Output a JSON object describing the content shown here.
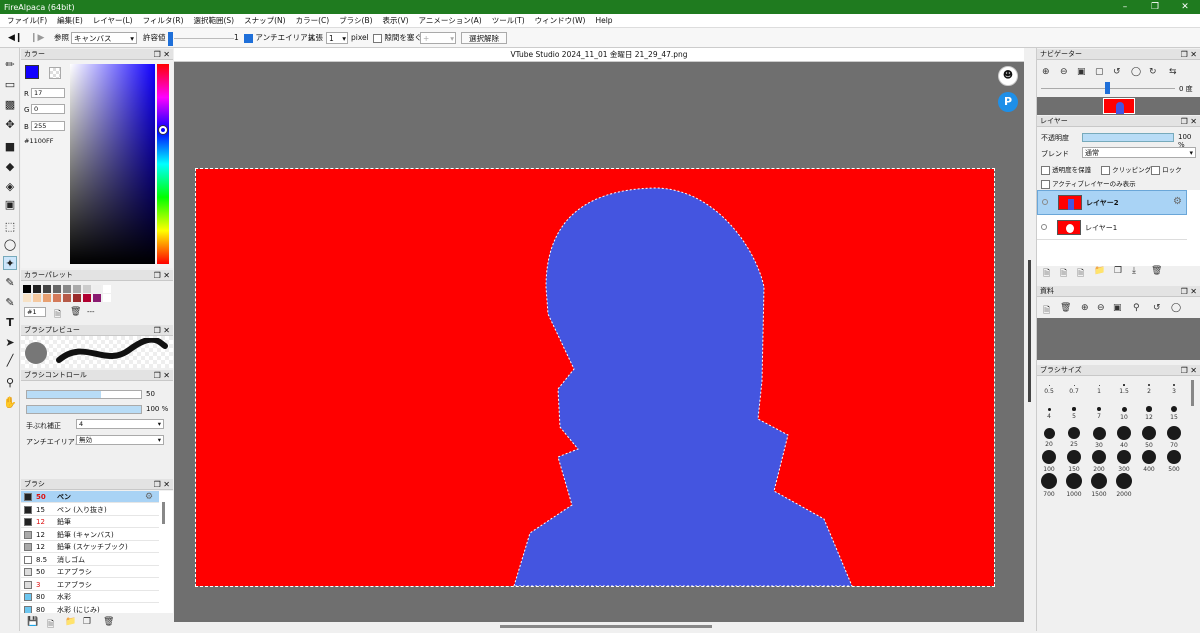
{
  "app": {
    "title": "FireAlpaca (64bit)",
    "colors": {
      "titlebar": "#1f7b1f",
      "canvas_fill": "#ff0000",
      "silhouette": "#4455e0",
      "accent": "#1e6fd9"
    }
  },
  "menu": [
    "ファイル(F)",
    "編集(E)",
    "レイヤー(L)",
    "フィルタ(R)",
    "選択範囲(S)",
    "スナップ(N)",
    "カラー(C)",
    "ブラシ(B)",
    "表示(V)",
    "アニメーション(A)",
    "ツール(T)",
    "ウィンドウ(W)",
    "Help"
  ],
  "toolbar": {
    "ref_label": "参照",
    "ref_value": "キャンバス",
    "tolerance_label": "許容値",
    "tolerance_value": "1",
    "antialias_label": "アンチエイリアス",
    "expand_label": "拡張",
    "expand_value": "1",
    "expand_unit": "pixel",
    "gap_label": "隙間を塞ぐ",
    "gap_value": "+",
    "deselect_label": "選択解除"
  },
  "document": {
    "title": "VTube Studio 2024_11_01 金曜日 21_29_47.png"
  },
  "color_panel": {
    "title": "カラー",
    "r_label": "R",
    "r": "17",
    "g_label": "G",
    "g": "0",
    "b_label": "B",
    "b": "255",
    "hex": "#1100FF",
    "current": "#1100ff"
  },
  "palette": {
    "title": "カラーパレット",
    "name": "#1",
    "extra": "---",
    "swatches_row1": [
      "#000000",
      "#222222",
      "#444444",
      "#666666",
      "#888888",
      "#aaaaaa",
      "#cccccc",
      "#eeeeee",
      "#ffffff"
    ],
    "swatches_row2": [
      "#f7e2c6",
      "#f5c9a0",
      "#e8a071",
      "#d47a5a",
      "#b65a48",
      "#9a2b2b",
      "#b00030",
      "#8a1a70",
      "#ffffff"
    ]
  },
  "brush_preview": {
    "title": "ブラシプレビュー"
  },
  "brush_control": {
    "title": "ブラシコントロール",
    "size": "50",
    "opacity": "100 %",
    "size_fill": 0.65,
    "opacity_fill": 1.0,
    "stabilizer_label": "手ぶれ補正",
    "stabilizer_value": "4",
    "aa_label": "アンチエイリアス",
    "aa_value": "無効"
  },
  "brushes": {
    "title": "ブラシ",
    "items": [
      {
        "size": "50",
        "name": "ペン",
        "selected": true,
        "red": true,
        "color": "#222222"
      },
      {
        "size": "15",
        "name": "ペン (入り抜き)",
        "selected": false,
        "red": false,
        "color": "#222222"
      },
      {
        "size": "12",
        "name": "鉛筆",
        "selected": false,
        "red": true,
        "color": "#222222"
      },
      {
        "size": "12",
        "name": "鉛筆 (キャンバス)",
        "selected": false,
        "red": false,
        "color": "#aaaaaa"
      },
      {
        "size": "12",
        "name": "鉛筆 (スケッチブック)",
        "selected": false,
        "red": false,
        "color": "#aaaaaa"
      },
      {
        "size": "8.5",
        "name": "消しゴム",
        "selected": false,
        "red": false,
        "color": "#ffffff"
      },
      {
        "size": "50",
        "name": "エアブラシ",
        "selected": false,
        "red": false,
        "color": "#dddddd"
      },
      {
        "size": "3",
        "name": "エアブラシ",
        "selected": false,
        "red": true,
        "color": "#dddddd"
      },
      {
        "size": "80",
        "name": "水彩",
        "selected": false,
        "red": false,
        "color": "#6cc6f0"
      },
      {
        "size": "80",
        "name": "水彩 (にじみ)",
        "selected": false,
        "red": false,
        "color": "#6cc6f0"
      }
    ]
  },
  "navigator": {
    "title": "ナビゲーター",
    "angle": "0 度"
  },
  "layers": {
    "title": "レイヤー",
    "opacity_label": "不透明度",
    "opacity_value": "100 %",
    "blend_label": "ブレンド",
    "blend_value": "通常",
    "protect_alpha": "透明度を保護",
    "clipping": "クリッピング",
    "lock": "ロック",
    "active_only": "アクティブレイヤーのみ表示",
    "items": [
      {
        "name": "レイヤー2",
        "selected": true
      },
      {
        "name": "レイヤー1",
        "selected": false
      }
    ]
  },
  "material": {
    "title": "資料"
  },
  "brush_size": {
    "title": "ブラシサイズ",
    "sizes": [
      "0.5",
      "0.7",
      "1",
      "1.5",
      "2",
      "3",
      "4",
      "5",
      "7",
      "10",
      "12",
      "15",
      "20",
      "25",
      "30",
      "40",
      "50",
      "70",
      "100",
      "150",
      "200",
      "300",
      "400",
      "500",
      "700",
      "1000",
      "1500",
      "2000"
    ]
  }
}
